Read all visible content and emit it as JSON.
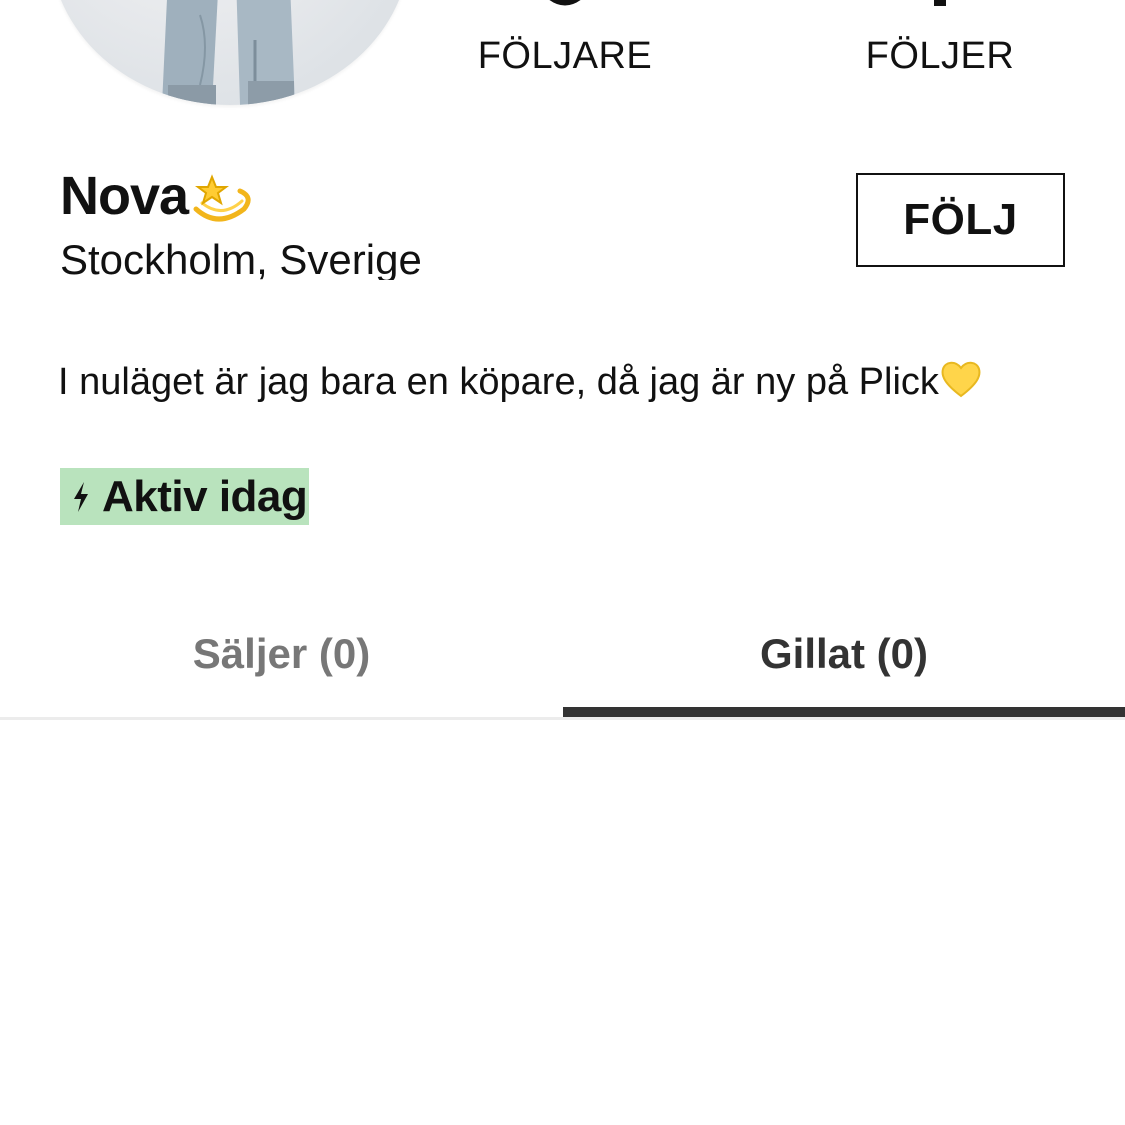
{
  "profile": {
    "name": "Nova",
    "location": "Stockholm, Sverige",
    "bio": "I nuläget är jag bara en köpare, då jag är ny på Plick",
    "active_status": "Aktiv idag",
    "follow_button": "FÖLJ"
  },
  "stats": {
    "followers_label": "FÖLJARE",
    "following_label": "FÖLJER"
  },
  "tabs": [
    {
      "label": "Säljer (0)",
      "selected": false
    },
    {
      "label": "Gillat (0)",
      "selected": true
    }
  ],
  "colors": {
    "active_badge_bg": "#b9e3bd",
    "tab_indicator": "#333333",
    "tab_inactive_text": "#777777"
  },
  "icons": {
    "name_emoji": "dizzy-icon",
    "bio_emoji": "yellow-heart-icon",
    "active_icon": "bolt-icon"
  }
}
